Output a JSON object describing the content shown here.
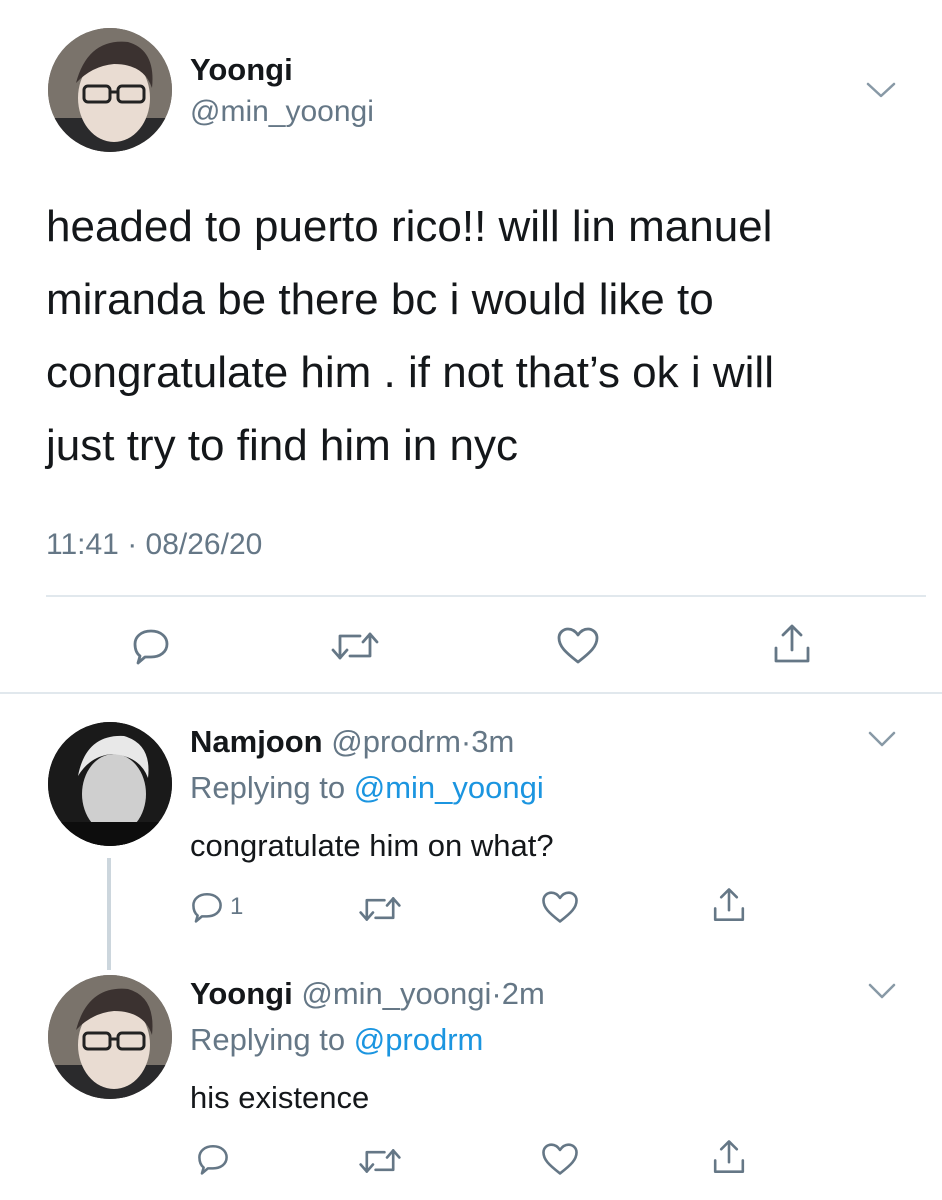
{
  "main_tweet": {
    "display_name": "Yoongi",
    "handle": "@min_yoongi",
    "text_lines": [
      "headed to puerto rico!! will lin manuel",
      "miranda be there bc i would like to",
      "congratulate him . if not that’s ok i will",
      "just try to find him in nyc"
    ],
    "time": "11:41",
    "separator": "·",
    "date": "08/26/20"
  },
  "replies": [
    {
      "display_name": "Namjoon",
      "handle": "@prodrm",
      "dot": "·",
      "time_ago": "3m",
      "replying_prefix": "Replying to",
      "replying_to": "@min_yoongi",
      "text": "congratulate him on what?",
      "reply_count": "1"
    },
    {
      "display_name": "Yoongi",
      "handle": "@min_yoongi",
      "dot": "·",
      "time_ago": "2m",
      "replying_prefix": "Replying to",
      "replying_to": "@prodrm",
      "text": "his existence",
      "reply_count": ""
    }
  ],
  "icons": [
    "chevron-down-icon",
    "reply-icon",
    "retweet-icon",
    "like-icon",
    "share-icon"
  ],
  "colors": {
    "text": "#14171a",
    "secondary": "#657786",
    "link": "#1b95e0",
    "divider": "#e1e8ed"
  }
}
